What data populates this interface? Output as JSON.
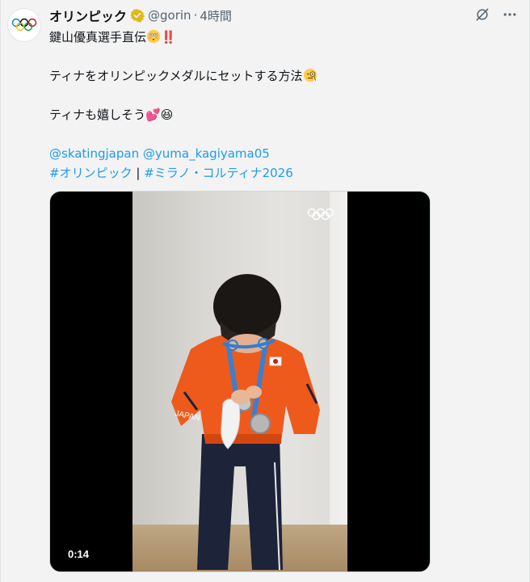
{
  "account": {
    "display_name": "オリンピック",
    "handle": "@gorin",
    "separator": "·",
    "timestamp": "4時間"
  },
  "tweet": {
    "line1": "鍵山優真選手直伝",
    "line1_emoji": "‼️",
    "line2": "ティナをオリンピックメダルにセットする方法",
    "line3": "ティナも嬉しそう",
    "line3_emoji1": "💕",
    "line3_emoji2": "😆",
    "mentions": [
      "@skatingjapan",
      "@yuma_kagiyama05"
    ],
    "hashtags": [
      "#オリンピック",
      "#ミラノ・コルティナ2026"
    ],
    "hashtag_separator": "|"
  },
  "media": {
    "duration": "0:14"
  },
  "colors": {
    "link": "#1d9bf0",
    "verified": "#e2b719",
    "text": "#0f1419",
    "muted": "#536471"
  },
  "icons": [
    "olympic-rings-icon",
    "verified-badge-icon",
    "grok-icon",
    "more-icon"
  ]
}
